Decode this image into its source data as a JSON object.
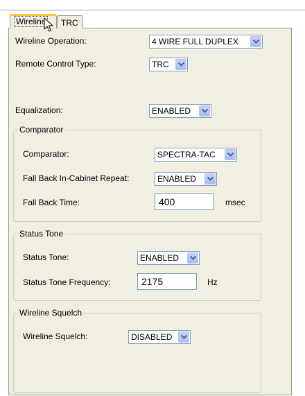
{
  "tabs": {
    "wireline": "Wireline",
    "trc": "TRC"
  },
  "wireline_operation": {
    "label": "Wireline Operation:",
    "value": "4 WIRE FULL DUPLEX"
  },
  "remote_control_type": {
    "label": "Remote Control Type:",
    "value": "TRC"
  },
  "equalization": {
    "label": "Equalization:",
    "value": "ENABLED"
  },
  "comparator_group": {
    "legend": "Comparator",
    "comparator": {
      "label": "Comparator:",
      "value": "SPECTRA-TAC"
    },
    "fallback_repeat": {
      "label": "Fall Back In-Cabinet Repeat:",
      "value": "ENABLED"
    },
    "fallback_time": {
      "label": "Fall Back Time:",
      "value": "400",
      "unit": "msec"
    }
  },
  "status_tone_group": {
    "legend": "Status Tone",
    "status_tone": {
      "label": "Status Tone:",
      "value": "ENABLED"
    },
    "frequency": {
      "label": "Status Tone Frequency:",
      "value": "2175",
      "unit": "Hz"
    }
  },
  "squelch_group": {
    "legend": "Wireline Squelch",
    "squelch": {
      "label": "Wireline Squelch:",
      "value": "DISABLED"
    }
  },
  "icons": {
    "dropdown": "chevron-down-icon",
    "cursor": "mouse-pointer-icon"
  }
}
